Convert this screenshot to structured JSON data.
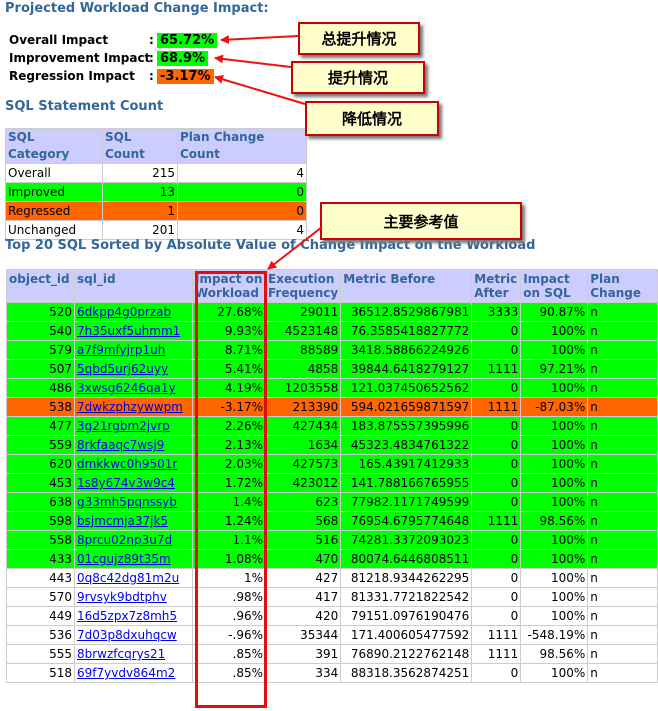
{
  "projected": {
    "title": "Projected Workload Change Impact:",
    "rows": [
      {
        "label": "Overall Impact",
        "colon": ":",
        "value": "65.72%",
        "color": "#00ff00"
      },
      {
        "label": "Improvement Impact",
        "colon": ":",
        "value": "68.9%",
        "color": "#00ff00"
      },
      {
        "label": "Regression Impact",
        "colon": ":",
        "value": "-3.17%",
        "color": "#ff6600"
      }
    ]
  },
  "callouts": {
    "overall": "总提升情况",
    "improve": "提升情况",
    "regress": "降低情况",
    "main": "主要参考值"
  },
  "sql_count": {
    "title": "SQL Statement Count",
    "headers": [
      "SQL Category",
      "SQL Count",
      "Plan Change Count"
    ],
    "rows": [
      {
        "category": "Overall",
        "count": "215",
        "plan": "4",
        "status": "none"
      },
      {
        "category": "Improved",
        "count": "13",
        "plan": "0",
        "status": "improved"
      },
      {
        "category": "Regressed",
        "count": "1",
        "plan": "0",
        "status": "regressed"
      },
      {
        "category": "Unchanged",
        "count": "201",
        "plan": "4",
        "status": "none"
      }
    ]
  },
  "top20": {
    "title": "Top 20 SQL Sorted by Absolute Value of Change Impact on the Workload",
    "headers": [
      "object_id",
      "sql_id",
      "Impact on Workload",
      "Execution Frequency",
      "Metric Before",
      "Metric After",
      "Impact on SQL",
      "Plan Change"
    ],
    "rows": [
      {
        "object_id": "520",
        "sql_id": "6dkpp4g0przab",
        "impact_workload": "27.68%",
        "exec_freq": "29011",
        "metric_before": "36512.8529867981",
        "metric_after": "3333",
        "impact_sql": "90.87%",
        "plan_change": "n",
        "status": "improved"
      },
      {
        "object_id": "540",
        "sql_id": "7h35uxf5uhmm1",
        "impact_workload": "9.93%",
        "exec_freq": "4523148",
        "metric_before": "76.3585418827772",
        "metric_after": "0",
        "impact_sql": "100%",
        "plan_change": "n",
        "status": "improved"
      },
      {
        "object_id": "579",
        "sql_id": "a7f9mfyjrp1uh",
        "impact_workload": "8.71%",
        "exec_freq": "88589",
        "metric_before": "3418.58866224926",
        "metric_after": "0",
        "impact_sql": "100%",
        "plan_change": "n",
        "status": "improved"
      },
      {
        "object_id": "507",
        "sql_id": "5qbd5urj62uyy",
        "impact_workload": "5.41%",
        "exec_freq": "4858",
        "metric_before": "39844.6418279127",
        "metric_after": "1111",
        "impact_sql": "97.21%",
        "plan_change": "n",
        "status": "improved"
      },
      {
        "object_id": "486",
        "sql_id": "3xwsg6246qa1y",
        "impact_workload": "4.19%",
        "exec_freq": "1203558",
        "metric_before": "121.037450652562",
        "metric_after": "0",
        "impact_sql": "100%",
        "plan_change": "n",
        "status": "improved"
      },
      {
        "object_id": "538",
        "sql_id": "7dwkzphzywwpm",
        "impact_workload": "-3.17%",
        "exec_freq": "213390",
        "metric_before": "594.021659871597",
        "metric_after": "1111",
        "impact_sql": "-87.03%",
        "plan_change": "n",
        "status": "regressed"
      },
      {
        "object_id": "477",
        "sql_id": "3g21rgbm2jvrp",
        "impact_workload": "2.26%",
        "exec_freq": "427434",
        "metric_before": "183.875557395996",
        "metric_after": "0",
        "impact_sql": "100%",
        "plan_change": "n",
        "status": "improved"
      },
      {
        "object_id": "559",
        "sql_id": "8rkfaaqc7wsj9",
        "impact_workload": "2.13%",
        "exec_freq": "1634",
        "metric_before": "45323.4834761322",
        "metric_after": "0",
        "impact_sql": "100%",
        "plan_change": "n",
        "status": "improved"
      },
      {
        "object_id": "620",
        "sql_id": "dmkkwc0h9501r",
        "impact_workload": "2.03%",
        "exec_freq": "427573",
        "metric_before": "165.43917412933",
        "metric_after": "0",
        "impact_sql": "100%",
        "plan_change": "n",
        "status": "improved"
      },
      {
        "object_id": "453",
        "sql_id": "1s8y674v3w9c4",
        "impact_workload": "1.72%",
        "exec_freq": "423012",
        "metric_before": "141.788166765955",
        "metric_after": "0",
        "impact_sql": "100%",
        "plan_change": "n",
        "status": "improved"
      },
      {
        "object_id": "638",
        "sql_id": "g33mh5pqnssyb",
        "impact_workload": "1.4%",
        "exec_freq": "623",
        "metric_before": "77982.1171749599",
        "metric_after": "0",
        "impact_sql": "100%",
        "plan_change": "n",
        "status": "improved"
      },
      {
        "object_id": "598",
        "sql_id": "bsjmcmja37jk5",
        "impact_workload": "1.24%",
        "exec_freq": "568",
        "metric_before": "76954.6795774648",
        "metric_after": "1111",
        "impact_sql": "98.56%",
        "plan_change": "n",
        "status": "improved"
      },
      {
        "object_id": "558",
        "sql_id": "8prcu02np3u7d",
        "impact_workload": "1.1%",
        "exec_freq": "516",
        "metric_before": "74281.3372093023",
        "metric_after": "0",
        "impact_sql": "100%",
        "plan_change": "n",
        "status": "improved"
      },
      {
        "object_id": "433",
        "sql_id": "01cgujz89t35m",
        "impact_workload": "1.08%",
        "exec_freq": "470",
        "metric_before": "80074.6446808511",
        "metric_after": "0",
        "impact_sql": "100%",
        "plan_change": "n",
        "status": "improved"
      },
      {
        "object_id": "443",
        "sql_id": "0q8c42dg81m2u",
        "impact_workload": "1%",
        "exec_freq": "427",
        "metric_before": "81218.9344262295",
        "metric_after": "0",
        "impact_sql": "100%",
        "plan_change": "n",
        "status": "none"
      },
      {
        "object_id": "570",
        "sql_id": "9rvsyk9bdtphv",
        "impact_workload": ".98%",
        "exec_freq": "417",
        "metric_before": "81331.7721822542",
        "metric_after": "0",
        "impact_sql": "100%",
        "plan_change": "n",
        "status": "none"
      },
      {
        "object_id": "449",
        "sql_id": "16d5zpx7z8mh5",
        "impact_workload": ".96%",
        "exec_freq": "420",
        "metric_before": "79151.0976190476",
        "metric_after": "0",
        "impact_sql": "100%",
        "plan_change": "n",
        "status": "none"
      },
      {
        "object_id": "536",
        "sql_id": "7d03p8dxuhqcw",
        "impact_workload": "-.96%",
        "exec_freq": "35344",
        "metric_before": "171.400605477592",
        "metric_after": "1111",
        "impact_sql": "-548.19%",
        "plan_change": "n",
        "status": "none"
      },
      {
        "object_id": "555",
        "sql_id": "8brwzfcqrys21",
        "impact_workload": ".85%",
        "exec_freq": "391",
        "metric_before": "76890.2122762148",
        "metric_after": "1111",
        "impact_sql": "98.56%",
        "plan_change": "n",
        "status": "none"
      },
      {
        "object_id": "518",
        "sql_id": "69f7yvdv864m2",
        "impact_workload": ".85%",
        "exec_freq": "334",
        "metric_before": "88318.3562874251",
        "metric_after": "0",
        "impact_sql": "100%",
        "plan_change": "n",
        "status": "none"
      }
    ]
  }
}
